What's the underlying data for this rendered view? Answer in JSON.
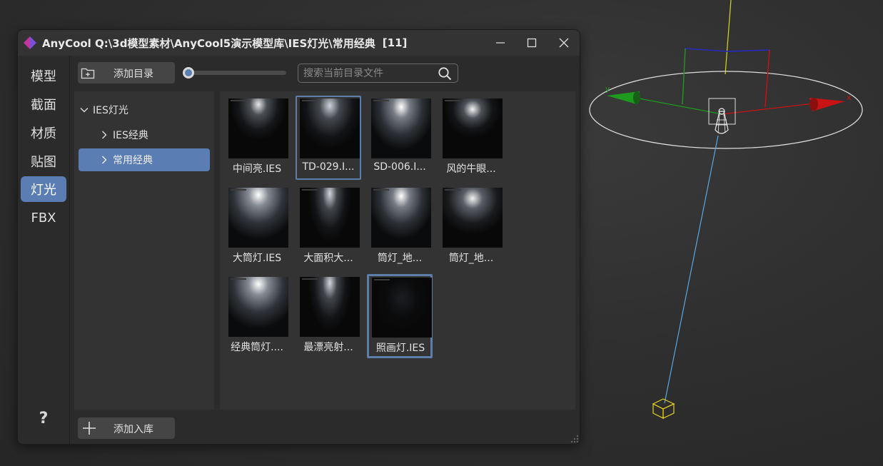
{
  "window": {
    "title": "AnyCool Q:\\3d模型素材\\AnyCool5演示模型库\\IES灯光\\常用经典",
    "count": "[11]"
  },
  "sidebar": {
    "items": [
      {
        "label": "模型",
        "active": false
      },
      {
        "label": "截面",
        "active": false
      },
      {
        "label": "材质",
        "active": false
      },
      {
        "label": "贴图",
        "active": false
      },
      {
        "label": "灯光",
        "active": true
      },
      {
        "label": "FBX",
        "active": false
      }
    ],
    "help_label": "?"
  },
  "toolbar": {
    "add_dir_label": "添加目录",
    "search_placeholder": "搜索当前目录文件",
    "search_value": ""
  },
  "tree": {
    "items": [
      {
        "label": "IES灯光",
        "expanded": true,
        "selected": false,
        "depth": 0
      },
      {
        "label": "IES经典",
        "expanded": false,
        "selected": false,
        "depth": 1
      },
      {
        "label": "常用经典",
        "expanded": false,
        "selected": true,
        "depth": 1
      }
    ]
  },
  "grid": {
    "items": [
      {
        "label": "中间亮.IES",
        "style": "cone",
        "state": "normal"
      },
      {
        "label": "TD-029.I...",
        "style": "cone-wide",
        "state": "hover"
      },
      {
        "label": "SD-006.I...",
        "style": "bright",
        "state": "normal"
      },
      {
        "label": "风的牛眼...",
        "style": "spot",
        "state": "normal"
      },
      {
        "label": "大筒灯.IES",
        "style": "bright-wide",
        "state": "normal"
      },
      {
        "label": "大面积大...",
        "style": "streak",
        "state": "normal"
      },
      {
        "label": "筒灯_地...",
        "style": "bright",
        "state": "normal"
      },
      {
        "label": "筒灯_地...",
        "style": "spot-wide",
        "state": "normal"
      },
      {
        "label": "经典筒灯....",
        "style": "bright-wide",
        "state": "normal"
      },
      {
        "label": "最漂亮射...",
        "style": "streak",
        "state": "normal"
      },
      {
        "label": "照画灯.IES",
        "style": "dim",
        "state": "selected"
      }
    ]
  },
  "bottom": {
    "add_lib_label": "添加入库"
  },
  "colors": {
    "accent": "#5a7db3",
    "selection_border": "#5d7ea8",
    "axis_x": "#c81414",
    "axis_y": "#1e9a1e",
    "target_line": "#5aa8e0",
    "target_box": "#e6d21e"
  }
}
